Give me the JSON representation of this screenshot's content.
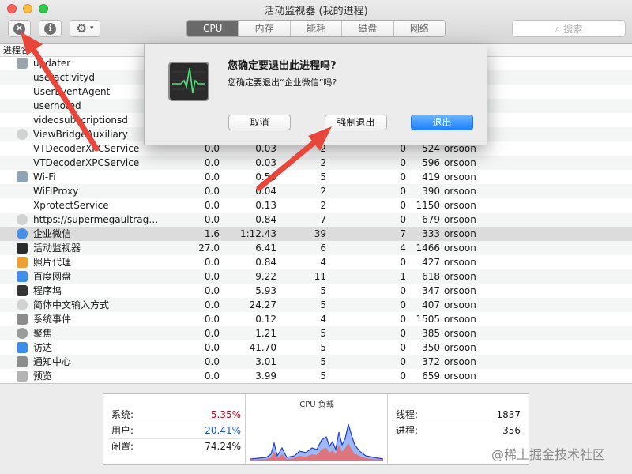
{
  "window": {
    "title": "活动监视器 (我的进程)",
    "traffic_colors": [
      "#fc605c",
      "#fdbc40",
      "#34c84a"
    ]
  },
  "toolbar": {
    "stop_glyph": "✕",
    "info_glyph": "i",
    "gear_glyph": "⚙",
    "chevron_glyph": "▾",
    "tabs": [
      {
        "label": "CPU",
        "active": true
      },
      {
        "label": "内存",
        "active": false
      },
      {
        "label": "能耗",
        "active": false
      },
      {
        "label": "磁盘",
        "active": false
      },
      {
        "label": "网络",
        "active": false
      }
    ],
    "search_placeholder": "搜索",
    "search_glyph": "⌕"
  },
  "table": {
    "header_label": "进程名",
    "rows": [
      {
        "name": "updater",
        "cpu": "",
        "time": "",
        "threads": "",
        "ports": "",
        "pid": "",
        "user": "",
        "icon": "generic",
        "icon_color": "#9aa4ad"
      },
      {
        "name": "useractivityd",
        "cpu": "",
        "time": "",
        "threads": "",
        "ports": "",
        "pid": "",
        "user": "",
        "icon": "",
        "icon_color": ""
      },
      {
        "name": "UserEventAgent",
        "cpu": "",
        "time": "",
        "threads": "",
        "ports": "",
        "pid": "",
        "user": "",
        "icon": "",
        "icon_color": ""
      },
      {
        "name": "usernoted",
        "cpu": "",
        "time": "",
        "threads": "",
        "ports": "",
        "pid": "",
        "user": "",
        "icon": "",
        "icon_color": ""
      },
      {
        "name": "videosubscriptionsd",
        "cpu": "",
        "time": "",
        "threads": "",
        "ports": "",
        "pid": "",
        "user": "",
        "icon": "",
        "icon_color": ""
      },
      {
        "name": "ViewBridgeAuxiliary",
        "cpu": "",
        "time": "",
        "threads": "",
        "ports": "",
        "pid": "",
        "user": "",
        "icon": "shield",
        "icon_color": "#d2d2d2"
      },
      {
        "name": "VTDecoderXPCService",
        "cpu": "0.0",
        "time": "0.03",
        "threads": "2",
        "ports": "0",
        "pid": "524",
        "user": "orsoon",
        "icon": "",
        "icon_color": ""
      },
      {
        "name": "VTDecoderXPCService",
        "cpu": "0.0",
        "time": "0.03",
        "threads": "2",
        "ports": "0",
        "pid": "596",
        "user": "orsoon",
        "icon": "",
        "icon_color": ""
      },
      {
        "name": "Wi-Fi",
        "cpu": "0.0",
        "time": "0.50",
        "threads": "5",
        "ports": "0",
        "pid": "419",
        "user": "orsoon",
        "icon": "wifi",
        "icon_color": "#8fa3b8"
      },
      {
        "name": "WiFiProxy",
        "cpu": "0.0",
        "time": "0.04",
        "threads": "2",
        "ports": "0",
        "pid": "390",
        "user": "orsoon",
        "icon": "",
        "icon_color": ""
      },
      {
        "name": "XprotectService",
        "cpu": "0.0",
        "time": "0.13",
        "threads": "2",
        "ports": "0",
        "pid": "1150",
        "user": "orsoon",
        "icon": "",
        "icon_color": ""
      },
      {
        "name": "https://supermegaultragroovy.com",
        "cpu": "0.0",
        "time": "0.84",
        "threads": "7",
        "ports": "0",
        "pid": "679",
        "user": "orsoon",
        "icon": "shield",
        "icon_color": "#d2d2d2"
      },
      {
        "name": "企业微信",
        "cpu": "1.6",
        "time": "1:12.43",
        "threads": "39",
        "ports": "7",
        "pid": "333",
        "user": "orsoon",
        "icon": "wecom",
        "icon_color": "#4a90e2",
        "selected": true
      },
      {
        "name": "活动监视器",
        "cpu": "27.0",
        "time": "6.41",
        "threads": "6",
        "ports": "4",
        "pid": "1466",
        "user": "orsoon",
        "icon": "activity",
        "icon_color": "#2b2b2b"
      },
      {
        "name": "照片代理",
        "cpu": "0.0",
        "time": "0.84",
        "threads": "4",
        "ports": "0",
        "pid": "427",
        "user": "orsoon",
        "icon": "photos",
        "icon_color": "#f0a030"
      },
      {
        "name": "百度网盘",
        "cpu": "0.0",
        "time": "9.22",
        "threads": "11",
        "ports": "1",
        "pid": "618",
        "user": "orsoon",
        "icon": "baidu",
        "icon_color": "#3f8ef0"
      },
      {
        "name": "程序坞",
        "cpu": "0.0",
        "time": "5.93",
        "threads": "5",
        "ports": "0",
        "pid": "347",
        "user": "orsoon",
        "icon": "dock",
        "icon_color": "#333333"
      },
      {
        "name": "简体中文输入方式",
        "cpu": "0.0",
        "time": "24.27",
        "threads": "5",
        "ports": "0",
        "pid": "407",
        "user": "orsoon",
        "icon": "shield",
        "icon_color": "#d2d2d2"
      },
      {
        "name": "系统事件",
        "cpu": "0.0",
        "time": "0.12",
        "threads": "4",
        "ports": "0",
        "pid": "1505",
        "user": "orsoon",
        "icon": "events",
        "icon_color": "#8c8c8c"
      },
      {
        "name": "聚焦",
        "cpu": "0.0",
        "time": "1.21",
        "threads": "5",
        "ports": "0",
        "pid": "385",
        "user": "orsoon",
        "icon": "spotlight",
        "icon_color": "#9a9a9a"
      },
      {
        "name": "访达",
        "cpu": "0.0",
        "time": "41.70",
        "threads": "5",
        "ports": "0",
        "pid": "350",
        "user": "orsoon",
        "icon": "finder",
        "icon_color": "#3d8ee8"
      },
      {
        "name": "通知中心",
        "cpu": "0.0",
        "time": "3.01",
        "threads": "5",
        "ports": "0",
        "pid": "372",
        "user": "orsoon",
        "icon": "notify",
        "icon_color": "#8c8c8c"
      },
      {
        "name": "预览",
        "cpu": "0.0",
        "time": "3.99",
        "threads": "5",
        "ports": "0",
        "pid": "659",
        "user": "orsoon",
        "icon": "preview",
        "icon_color": "#b3b3b3"
      }
    ]
  },
  "stats": {
    "system_label": "系统:",
    "system_value": "5.35%",
    "system_color": "#d0021b",
    "user_label": "用户:",
    "user_value": "20.41%",
    "user_color": "#1a56d6",
    "idle_label": "闲置:",
    "idle_value": "74.24%",
    "graph_title": "CPU 负载",
    "threads_label": "线程:",
    "threads_value": "1837",
    "processes_label": "进程:",
    "processes_value": "356"
  },
  "dialog": {
    "title": "您确定要退出此进程吗?",
    "message": "您确定要退出“企业微信”吗?",
    "cancel_label": "取消",
    "force_quit_label": "强制退出",
    "quit_label": "退出",
    "accent_color": "#1a82fb"
  },
  "annotation": {
    "arrow_color": "#e8463a"
  },
  "watermark": "@稀土掘金技术社区"
}
